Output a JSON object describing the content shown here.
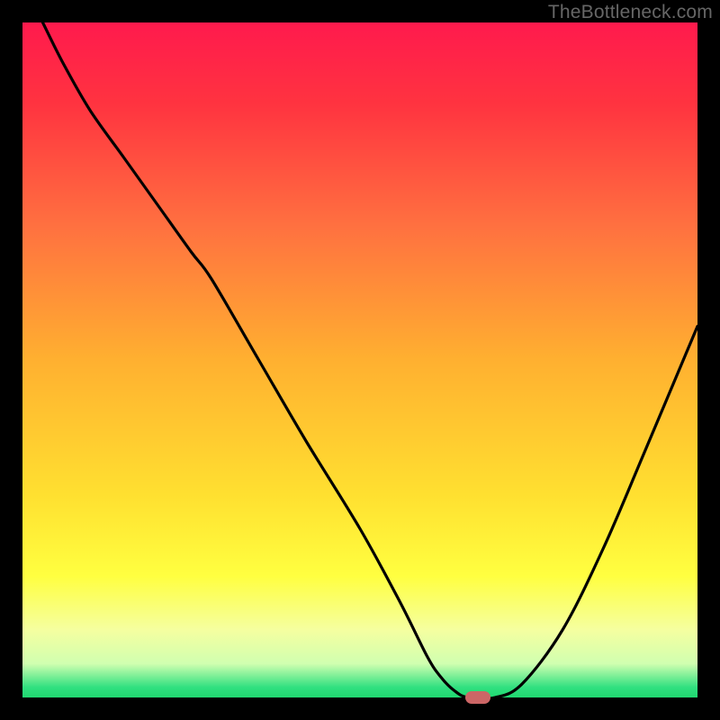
{
  "watermark": {
    "text": "TheBottleneck.com"
  },
  "marker": {
    "color": "#cc6666"
  },
  "chart_data": {
    "type": "line",
    "title": "",
    "xlabel": "",
    "ylabel": "",
    "xlim": [
      0,
      100
    ],
    "ylim": [
      0,
      100
    ],
    "gradient_stops": [
      {
        "t": 0.0,
        "color": "#ff1a4d"
      },
      {
        "t": 0.12,
        "color": "#ff3340"
      },
      {
        "t": 0.3,
        "color": "#ff7040"
      },
      {
        "t": 0.5,
        "color": "#ffb030"
      },
      {
        "t": 0.7,
        "color": "#ffe030"
      },
      {
        "t": 0.82,
        "color": "#ffff40"
      },
      {
        "t": 0.9,
        "color": "#f5ffa0"
      },
      {
        "t": 0.95,
        "color": "#d0ffb0"
      },
      {
        "t": 0.985,
        "color": "#30e080"
      },
      {
        "t": 1.0,
        "color": "#20d870"
      }
    ],
    "series": [
      {
        "name": "bottleneck-curve",
        "color": "#000000",
        "x": [
          3,
          6,
          10,
          15,
          20,
          25,
          28,
          35,
          42,
          50,
          56,
          60,
          62,
          64,
          66,
          70,
          74,
          80,
          86,
          92,
          100
        ],
        "y": [
          100,
          94,
          87,
          80,
          73,
          66,
          62,
          50,
          38,
          25,
          14,
          6,
          3,
          1,
          0,
          0,
          2,
          10,
          22,
          36,
          55
        ]
      }
    ],
    "optimal_marker": {
      "x": 67.5,
      "y": 0
    }
  }
}
